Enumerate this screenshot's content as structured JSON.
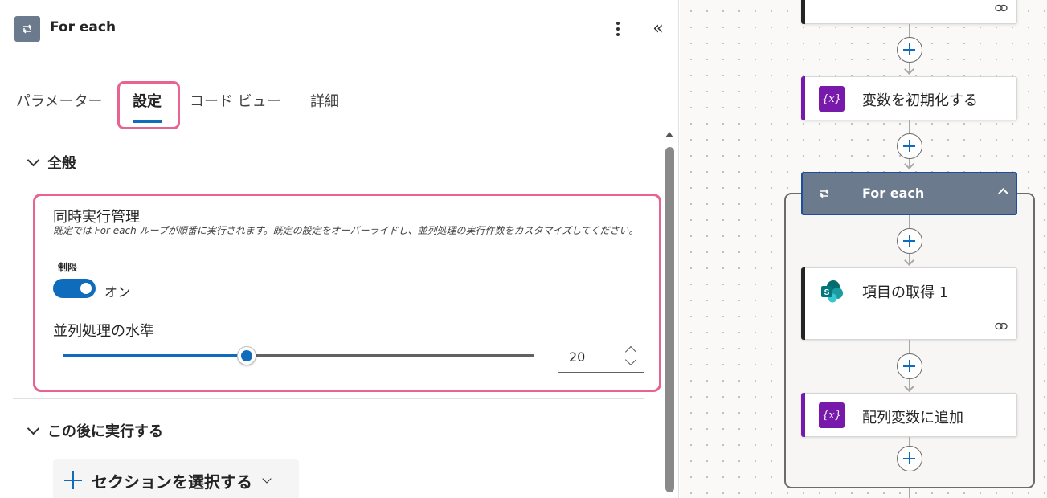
{
  "panel": {
    "title": "For each",
    "tabs": [
      {
        "label": "パラメーター",
        "active": false
      },
      {
        "label": "設定",
        "active": true
      },
      {
        "label": "コード ビュー",
        "active": false
      },
      {
        "label": "詳細",
        "active": false
      }
    ],
    "general": {
      "header": "全般",
      "concurrency": {
        "title": "同時実行管理",
        "description": "既定では For each ループが順番に実行されます。既定の設定をオーバーライドし、並列処理の実行件数をカスタマイズしてください。",
        "limit_label": "制限",
        "toggle_state": "オン",
        "toggle_on": true,
        "parallel_label": "並列処理の水準",
        "parallel_value": "20",
        "slider_fraction": 0.39
      }
    },
    "run_after": {
      "header": "この後に実行する",
      "select_label": "セクションを選択する"
    }
  },
  "canvas": {
    "nodes": [
      {
        "label": "変数を初期化する",
        "type": "variable",
        "accent": "#7719aa"
      },
      {
        "label": "For each",
        "type": "foreach",
        "accent": "#6b7a8c"
      },
      {
        "label": "項目の取得 1",
        "type": "sharepoint",
        "accent": "#038387"
      },
      {
        "label": "配列変数に追加",
        "type": "variable",
        "accent": "#7719aa"
      }
    ]
  },
  "colors": {
    "accent": "#0f6cbd",
    "highlight": "#e8648f",
    "variable": "#7719aa",
    "foreach": "#6b7a8c"
  }
}
